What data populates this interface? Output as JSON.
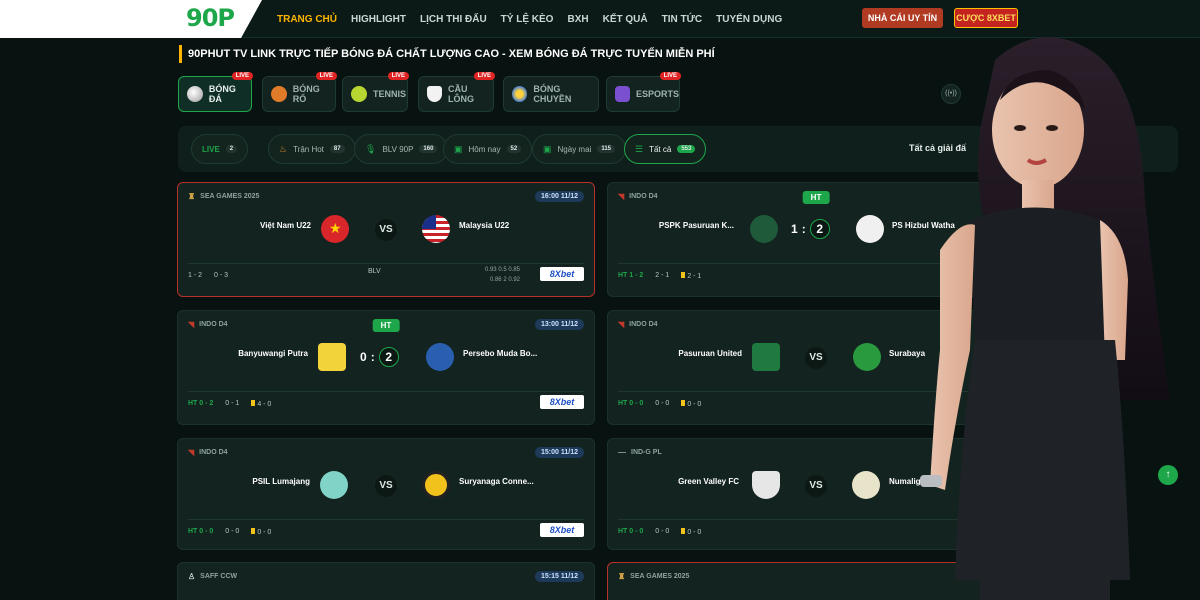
{
  "header": {
    "logo": "90P",
    "nav": [
      "TRANG CHỦ",
      "HIGHLIGHT",
      "LỊCH THI ĐẤU",
      "TỶ LỆ KÈO",
      "BXH",
      "KẾT QUẢ",
      "TIN TỨC",
      "TUYỂN DỤNG"
    ],
    "nhacai_label": "NHÀ CÁI UY TÍN",
    "cuoc_label": "CƯỢC 8XBET"
  },
  "title": "90PHUT TV LINK TRỰC TIẾP BÓNG ĐÁ CHẤT LƯỢNG CAO - XEM BÓNG ĐÁ TRỰC TUYẾN MIỄN PHÍ",
  "sport_tabs": [
    {
      "label": "BÓNG ĐÁ",
      "live": "Live",
      "color": "#e8e8e8"
    },
    {
      "label": "BÓNG RỔ",
      "live": "Live",
      "color": "#e07b2a"
    },
    {
      "label": "TENNIS",
      "live": "Live",
      "color": "#b8d632"
    },
    {
      "label": "CẦU LÔNG",
      "live": "Live",
      "color": "#f2f2f2"
    },
    {
      "label": "BÓNG CHUYỀN",
      "live": "Live",
      "color": "#4a7fd0"
    },
    {
      "label": "ESPORTS",
      "live": "Live",
      "color": "#7a4fd0"
    }
  ],
  "radio_text": "((•))",
  "filters": [
    {
      "label": "LIVE",
      "count": "2"
    },
    {
      "label": "Trận Hot",
      "count": "87"
    },
    {
      "label": "BLV 90P",
      "count": "160"
    },
    {
      "label": "Hôm nay",
      "count": "52"
    },
    {
      "label": "Ngày mai",
      "count": "115"
    },
    {
      "label": "Tất cả",
      "count": "553"
    }
  ],
  "all_leagues": "Tất cả giải đấ",
  "matches": [
    {
      "league": "SEA GAMES 2025",
      "time": "16:00 11/12",
      "home": "Việt Nam U22",
      "away": "Malaysia U22",
      "foot1": "1 - 2",
      "foot2": "0 - 3",
      "blv": "BLV",
      "odds1": "0.93   0.5   0.85",
      "odds2": "0.86   2   0.92",
      "bet": "8Xbet"
    },
    {
      "league": "INDO D4",
      "status": "HT",
      "home": "PSPK Pasuruan K...",
      "away": "PS Hizbul Watha",
      "score_h": "1",
      "score_a": "2",
      "ht": "HT 1 - 2",
      "corner": "2 - 1",
      "yellow": "2 - 1"
    },
    {
      "league": "INDO D4",
      "status": "HT",
      "time": "13:00 11/12",
      "home": "Banyuwangi Putra",
      "away": "Persebo Muda Bo...",
      "score_h": "0",
      "score_a": "2",
      "ht": "HT 0 - 2",
      "corner": "0 - 1",
      "yellow": "4 - 0",
      "bet": "8Xbet"
    },
    {
      "league": "INDO D4",
      "home": "Pasuruan United",
      "away": "Surabaya",
      "ht": "HT 0 - 0",
      "corner": "0 - 0",
      "yellow": "0 - 0"
    },
    {
      "league": "INDO D4",
      "time": "15:00 11/12",
      "home": "PSIL Lumajang",
      "away": "Suryanaga Conne...",
      "ht": "HT 0 - 0",
      "corner": "0 - 0",
      "yellow": "0 - 0",
      "bet": "8Xbet"
    },
    {
      "league": "IND-G PL",
      "home": "Green Valley FC",
      "away": "Numalig",
      "ht": "HT 0 - 0",
      "corner": "0 - 0",
      "yellow": "0 - 0"
    },
    {
      "league": "SAFF CCW",
      "time": "15:15 11/12"
    },
    {
      "league": "SEA GAMES 2025"
    }
  ],
  "vs": "VS",
  "colors": {
    "accent": "#1ea64a",
    "active_nav": "#ffb400",
    "card": "#13231f",
    "live": "#e02424"
  }
}
